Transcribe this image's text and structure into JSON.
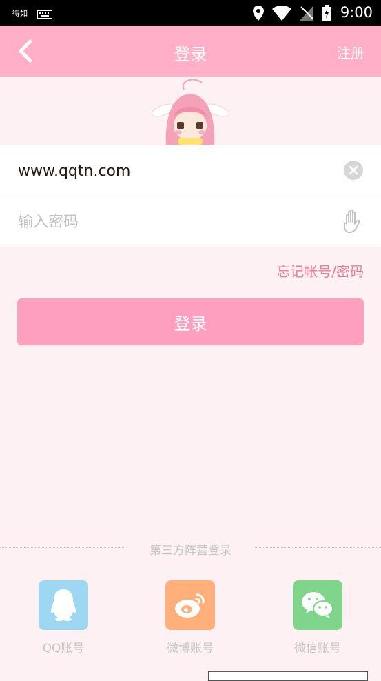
{
  "status_bar": {
    "app_label": "得如",
    "time": "9:00"
  },
  "header": {
    "title": "登录",
    "register_label": "注册"
  },
  "form": {
    "username_value": "www.qqtn.com",
    "password_placeholder": "输入密码"
  },
  "forgot_label": "忘记帐号/密码",
  "login_button_label": "登录",
  "third_party": {
    "heading": "第三方阵营登录",
    "items": [
      {
        "label": "QQ账号",
        "color": "#9ed7f1",
        "icon": "qq-penguin-icon"
      },
      {
        "label": "微博账号",
        "color": "#ffb07a",
        "icon": "weibo-icon"
      },
      {
        "label": "微信账号",
        "color": "#7fd68a",
        "icon": "wechat-icon"
      }
    ]
  },
  "colors": {
    "header": "#ffb0c8",
    "login_button": "#ff9fc0",
    "forgot_link": "#f07b9c",
    "background": "#fdf1f3"
  }
}
